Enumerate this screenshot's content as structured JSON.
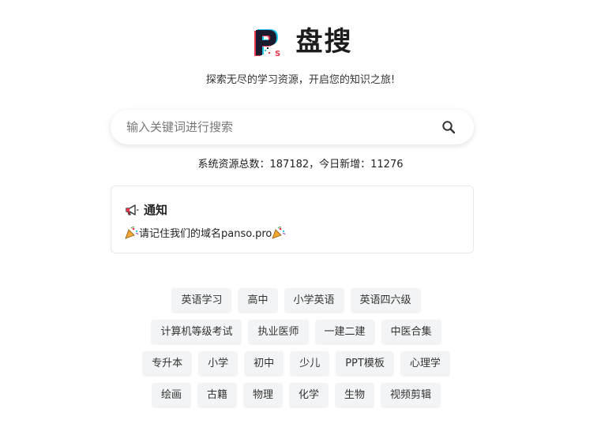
{
  "header": {
    "brand_name": "盘搜",
    "tagline": "探索无尽的学习资源，开启您的知识之旅!"
  },
  "search": {
    "placeholder": "输入关键词进行搜索",
    "value": ""
  },
  "stats": {
    "text": "系统资源总数：187182，今日新增：11276"
  },
  "notice": {
    "title": "通知",
    "message": "请记住我们的域名panso.pro"
  },
  "tags": {
    "rows": [
      [
        "英语学习",
        "高中",
        "小学英语",
        "英语四六级"
      ],
      [
        "计算机等级考试",
        "执业医师",
        "一建二建",
        "中医合集"
      ],
      [
        "专升本",
        "小学",
        "初中",
        "少儿",
        "PPT模板",
        "心理学"
      ],
      [
        "绘画",
        "古籍",
        "物理",
        "化学",
        "生物",
        "视频剪辑"
      ]
    ]
  },
  "colors": {
    "logo_dark": "#1a1a2e",
    "logo_red": "#e8344e",
    "logo_cyan": "#22c3e6",
    "tag_bg": "#f3f4f6"
  }
}
